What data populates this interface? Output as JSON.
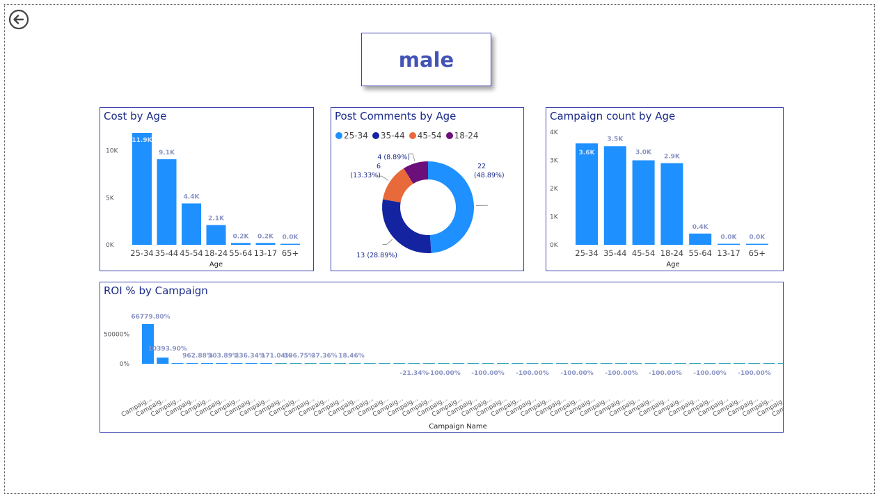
{
  "page": {
    "title": "male"
  },
  "icons": {
    "back": "back-arrow-icon"
  },
  "colors": {
    "bar": "#1e90ff",
    "data_label": "#8a93c4",
    "title": "#1a2a8a",
    "border": "#3d44b0"
  },
  "chart_data": [
    {
      "id": "cost",
      "type": "bar",
      "title": "Cost by Age",
      "xlabel": "Age",
      "ylabel": "",
      "categories": [
        "25-34",
        "35-44",
        "45-54",
        "18-24",
        "55-64",
        "13-17",
        "65+"
      ],
      "values": [
        11900,
        9100,
        4400,
        2100,
        200,
        200,
        0
      ],
      "data_labels": [
        "11.9K",
        "9.1K",
        "4.4K",
        "2.1K",
        "0.2K",
        "0.2K",
        "0.0K"
      ],
      "yticks": [
        0,
        5000,
        10000
      ],
      "ytick_labels": [
        "0K",
        "5K",
        "10K"
      ],
      "ylim": [
        0,
        11900
      ]
    },
    {
      "id": "comments",
      "type": "pie",
      "title": "Post Comments by Age",
      "donut": true,
      "legend_position": "top-left",
      "slices": [
        {
          "label": "25-34",
          "value": 22,
          "pct": "48.89%",
          "text": "22 (48.89%)",
          "color": "#1e90ff"
        },
        {
          "label": "35-44",
          "value": 13,
          "pct": "28.89%",
          "text": "13 (28.89%)",
          "color": "#1424a0"
        },
        {
          "label": "45-54",
          "value": 6,
          "pct": "13.33%",
          "text": "6 (13.33%)",
          "color": "#e8693a"
        },
        {
          "label": "18-24",
          "value": 4,
          "pct": "8.89%",
          "text": "4 (8.89%)",
          "color": "#6b0f7a"
        }
      ]
    },
    {
      "id": "campaigns",
      "type": "bar",
      "title": "Campaign count by Age",
      "xlabel": "Age",
      "ylabel": "",
      "categories": [
        "25-34",
        "35-44",
        "45-54",
        "18-24",
        "55-64",
        "13-17",
        "65+"
      ],
      "values": [
        3600,
        3500,
        3000,
        2900,
        400,
        0,
        0
      ],
      "data_labels": [
        "3.6K",
        "3.5K",
        "3.0K",
        "2.9K",
        "0.4K",
        "0.0K",
        "0.0K"
      ],
      "yticks": [
        0,
        1000,
        2000,
        3000,
        4000
      ],
      "ytick_labels": [
        "0K",
        "1K",
        "2K",
        "3K",
        "4K"
      ],
      "ylim": [
        0,
        4000
      ]
    },
    {
      "id": "roi",
      "type": "bar",
      "title": "ROI % by Campaign",
      "xlabel": "Campaign Name",
      "ylabel": "",
      "category_label": "Campaig...",
      "values": [
        66779.8,
        10393.9,
        962.88,
        303.89,
        236.34,
        171.04,
        106.75,
        37.36,
        18.46,
        -21.34,
        -100,
        -100,
        -100,
        -100,
        -100,
        -100,
        -100,
        -100,
        -100,
        -100,
        -100,
        -100,
        -100,
        -100,
        -100,
        -100,
        -100,
        -100,
        -100,
        -100,
        -100,
        -100,
        -100,
        -100,
        -100,
        -100,
        -100,
        -100,
        -100,
        -100,
        -100,
        -100,
        -100,
        -100,
        -100,
        -100,
        -100,
        -100,
        -100,
        -100
      ],
      "data_labels": [
        "66779.80%",
        "10393.90%",
        "962.88%",
        "303.89%",
        "236.34%",
        "171.04%",
        "106.75%",
        "37.36%",
        "18.46%",
        "-21.34%",
        "-100.00%",
        "-100.00%",
        "-100.00%",
        "-100.00%",
        "-100.00%",
        "-100.00%",
        "-100.00%",
        "-100.00%",
        "-100.00%",
        "-100.00%",
        "-100.00%"
      ],
      "yticks": [
        0,
        50000
      ],
      "ytick_labels": [
        "0%",
        "50000%"
      ],
      "ylim": [
        0,
        66779.8
      ]
    }
  ]
}
